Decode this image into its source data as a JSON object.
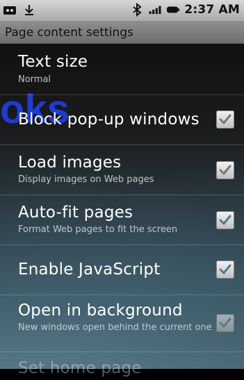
{
  "status_bar": {
    "time": "2:37 AM",
    "left_icons": [
      "voicemail-icon",
      "download-icon"
    ],
    "right_icons": [
      "bluetooth-icon",
      "signal-icon",
      "battery-icon"
    ]
  },
  "header": {
    "title": "Page content settings"
  },
  "settings": [
    {
      "title": "Text size",
      "summary": "Normal",
      "has_checkbox": false
    },
    {
      "title": "Block pop-up windows",
      "summary": "",
      "has_checkbox": true,
      "checked": true
    },
    {
      "title": "Load images",
      "summary": "Display images on Web pages",
      "has_checkbox": true,
      "checked": true
    },
    {
      "title": "Auto-fit pages",
      "summary": "Format Web pages to fit the screen",
      "has_checkbox": true,
      "checked": true
    },
    {
      "title": "Enable JavaScript",
      "summary": "",
      "has_checkbox": true,
      "checked": true
    },
    {
      "title": "Open in background",
      "summary": "New windows open behind the current one",
      "has_checkbox": true,
      "checked": true
    },
    {
      "title": "Set home page",
      "summary": "",
      "has_checkbox": false
    }
  ],
  "overlay_logo_text": "oks"
}
